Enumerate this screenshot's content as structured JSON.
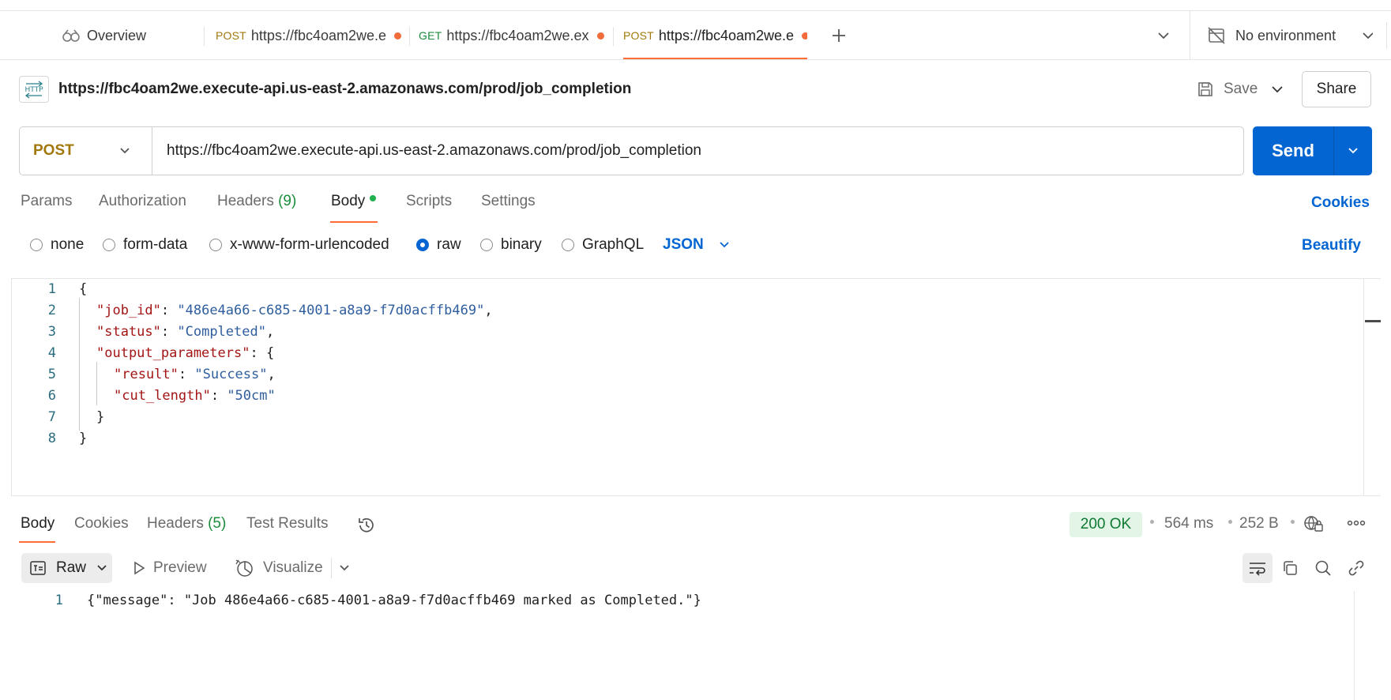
{
  "tabs": [
    {
      "label": "Overview"
    },
    {
      "method": "POST",
      "label": "https://fbc4oam2we.e"
    },
    {
      "method": "GET",
      "label": "https://fbc4oam2we.exe"
    },
    {
      "method": "POST",
      "label": "https://fbc4oam2we.e"
    }
  ],
  "environment": {
    "label": "No environment"
  },
  "request": {
    "title_url": "https://fbc4oam2we.execute-api.us-east-2.amazonaws.com/prod/job_completion",
    "method": "POST",
    "url": "https://fbc4oam2we.execute-api.us-east-2.amazonaws.com/prod/job_completion",
    "send_label": "Send",
    "save_label": "Save",
    "share_label": "Share",
    "icon_text": "HTTP"
  },
  "request_tabs": {
    "params": "Params",
    "authorization": "Authorization",
    "headers": "Headers",
    "headers_count": "(9)",
    "body": "Body",
    "scripts": "Scripts",
    "settings": "Settings",
    "cookies": "Cookies"
  },
  "body_types": {
    "none": "none",
    "form_data": "form-data",
    "urlencoded": "x-www-form-urlencoded",
    "raw": "raw",
    "binary": "binary",
    "graphql": "GraphQL",
    "format": "JSON",
    "beautify": "Beautify",
    "selected": "raw"
  },
  "editor": {
    "line_numbers": [
      "1",
      "2",
      "3",
      "4",
      "5",
      "6",
      "7",
      "8"
    ],
    "open_brace": "{",
    "close_brace": "}",
    "job_id_key": "\"job_id\"",
    "job_id_value": "\"486e4a66-c685-4001-a8a9-f7d0acffb469\"",
    "status_key": "\"status\"",
    "status_value": "\"Completed\"",
    "output_key": "\"output_parameters\"",
    "result_key": "\"result\"",
    "result_value": "\"Success\"",
    "cut_key": "\"cut_length\"",
    "cut_value": "\"50cm\"",
    "colon": ": ",
    "comma": ","
  },
  "response": {
    "tabs": {
      "body": "Body",
      "cookies": "Cookies",
      "headers": "Headers",
      "headers_count": "(5)",
      "test_results": "Test Results"
    },
    "status": "200 OK",
    "time": "564 ms",
    "size": "252 B",
    "view": {
      "raw": "Raw",
      "preview": "Preview",
      "visualize": "Visualize"
    },
    "line_number": "1",
    "body_text": "{\"message\": \"Job 486e4a66-c685-4001-a8a9-f7d0acffb469 marked as Completed.\"}"
  },
  "colors": {
    "accent": "#ff6c37",
    "primary": "#0265d2",
    "post": "#a2780c",
    "get": "#1b8d3c",
    "status_ok_bg": "#e2f5e7"
  }
}
